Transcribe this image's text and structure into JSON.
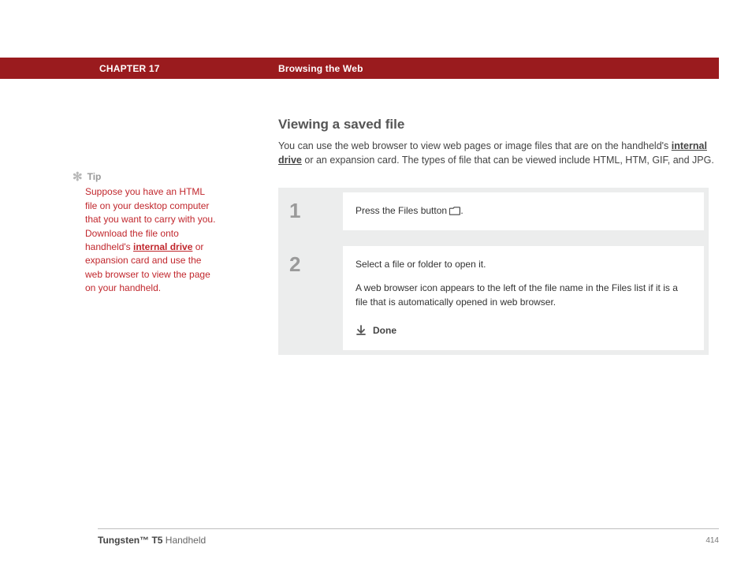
{
  "header": {
    "chapter": "CHAPTER 17",
    "title": "Browsing the Web"
  },
  "main": {
    "heading": "Viewing a saved file",
    "intro_before": "You can use the web browser to view web pages or image files that are on the handheld's ",
    "intro_link": "internal drive",
    "intro_after": " or an expansion card. The types of file that can be viewed include HTML, HTM, GIF, and JPG."
  },
  "steps": [
    {
      "num": "1",
      "line1_before": "Press the Files button ",
      "line1_after": "."
    },
    {
      "num": "2",
      "line1": "Select a file or folder to open it.",
      "line2": "A web browser icon appears to the left of the file name in the Files list if it is a file that is automatically opened in web browser.",
      "done": "Done"
    }
  ],
  "tip": {
    "label": "Tip",
    "body_before": "Suppose you have an HTML file on your desktop computer that you want to carry with you. Download the file onto handheld's ",
    "link": "internal drive",
    "body_after": " or expansion card and use the web browser to view the page on your handheld."
  },
  "footer": {
    "product_bold": "Tungsten™ T5",
    "product_rest": " Handheld",
    "page": "414"
  }
}
